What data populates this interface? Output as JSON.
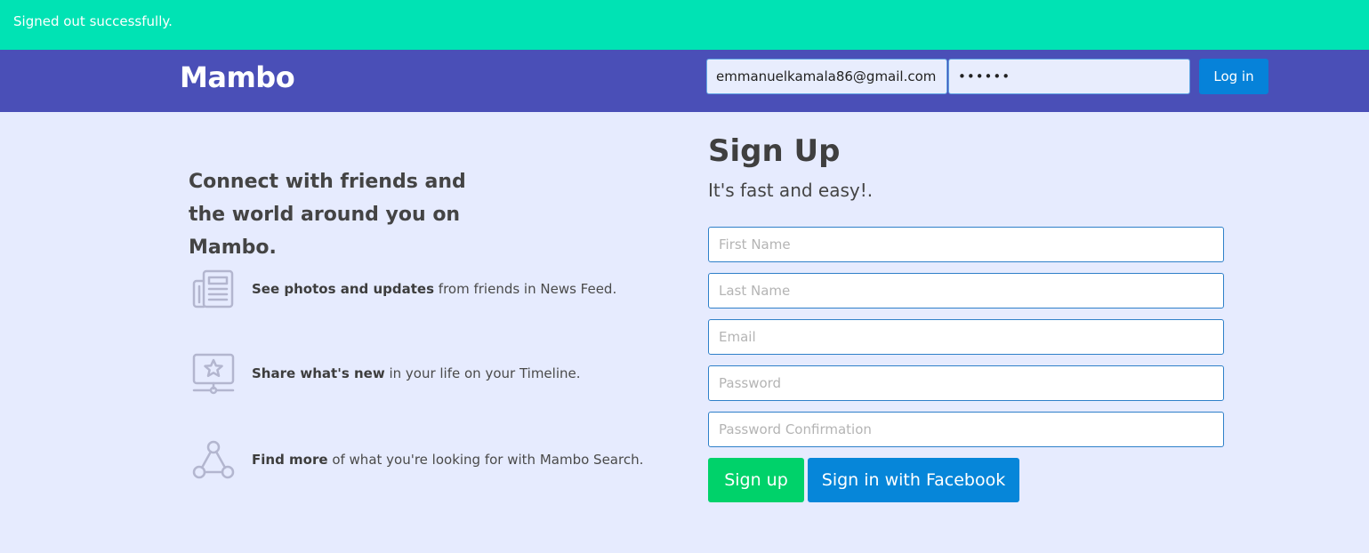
{
  "flash": {
    "message": "Signed out successfully."
  },
  "navbar": {
    "brand": "Mambo",
    "email_value": "emmanuelkamala86@gmail.com",
    "password_value": "••••••",
    "login_label": "Log in"
  },
  "intro": {
    "tagline": "Connect with friends and the world around you on Mambo.",
    "features": [
      {
        "icon": "newspaper-icon",
        "bold": "See photos and updates",
        "rest": " from friends in News Feed."
      },
      {
        "icon": "star-monitor-icon",
        "bold": "Share what's new",
        "rest": " in your life on your Timeline."
      },
      {
        "icon": "share-nodes-icon",
        "bold": "Find more",
        "rest": " of what you're looking for with Mambo Search."
      }
    ]
  },
  "signup": {
    "title": "Sign Up",
    "subtitle": "It's fast and easy!.",
    "fields": {
      "first_name": "First Name",
      "last_name": "Last Name",
      "email": "Email",
      "password": "Password",
      "password_confirmation": "Password Confirmation"
    },
    "signup_label": "Sign up",
    "facebook_label": "Sign in with Facebook"
  },
  "colors": {
    "flash": "#00e3b4",
    "navbar": "#4a4fb7",
    "background": "#e6ebfe",
    "primary": "#0682d9",
    "success": "#00d26a",
    "icon": "#b3b6cf"
  }
}
